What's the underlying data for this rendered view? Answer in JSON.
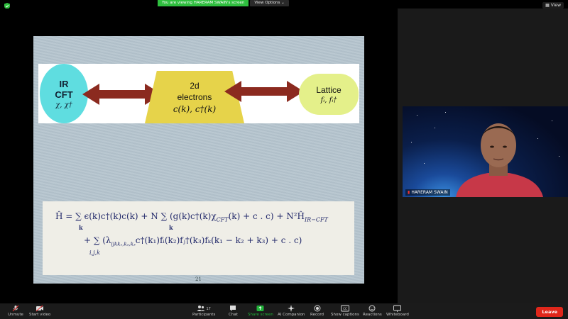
{
  "banner": {
    "viewing_notice": "You are viewing HARERAM SWAIN's screen",
    "view_options": "View Options",
    "view_button": "View"
  },
  "slide": {
    "diagram": {
      "ir": {
        "line1": "IR",
        "line2": "CFT",
        "math": "χ, χ†"
      },
      "middle": {
        "line1": "2d",
        "line2": "electrons",
        "math": "c(k), c†(k)"
      },
      "lattice": {
        "label": "Lattice",
        "math": "fᵢ, fᵢ†"
      }
    },
    "equation": {
      "line1": "Ĥ = ∑ ϵ(k)c†(k)c(k) + N ∑ (g(k)c†(k)χ",
      "line1_sub": "CFT",
      "line1_tail": "(k) + c . c) + N²Ĥ",
      "line1_sub2": "IR−CFT",
      "line1_k1": "k",
      "line1_k2": "k",
      "line2": "+ ∑ (λ",
      "line2_sub": "ijkk₁,k₂,k₃",
      "line2_tail": "c†(k₁)fᵢ(k₂)fⱼ†(k₃)fₖ(k₁ − k₂ + k₃) + c . c)",
      "line2_idx": "i,j,k"
    },
    "page_number": "21"
  },
  "participant": {
    "name": "HARERAM SWAIN"
  },
  "toolbar": {
    "unmute": "Unmute",
    "start_video": "Start video",
    "participants": "Participants",
    "participants_count": "17",
    "chat": "Chat",
    "share_screen": "Share screen",
    "ai_companion": "AI Companion",
    "record": "Record",
    "show_captions": "Show captions",
    "reactions": "Reactions",
    "whiteboard": "Whiteboard",
    "leave": "Leave"
  },
  "colors": {
    "banner_green": "#2fbf3f",
    "leave_red": "#e0271b",
    "share_green": "#22b33a",
    "ir_cyan": "#5fdde0",
    "electrons_yellow": "#e6d34a",
    "lattice_yellow": "#e4f08a",
    "arrow_brown": "#8b2a1f",
    "equation_ink": "#232a6b"
  }
}
